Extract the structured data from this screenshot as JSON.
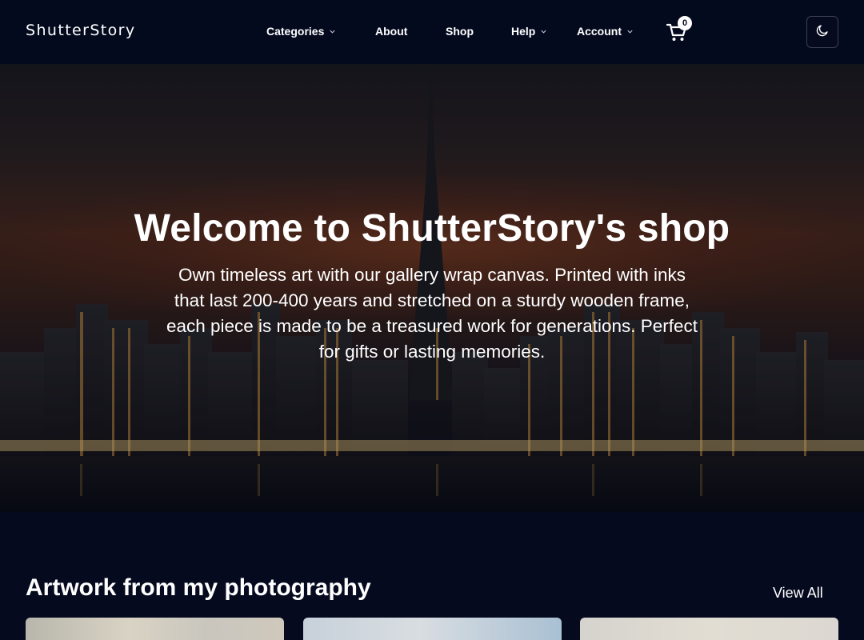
{
  "header": {
    "brand": "ShutterStory",
    "nav": [
      {
        "label": "Categories",
        "has_dropdown": true
      },
      {
        "label": "About",
        "has_dropdown": false
      },
      {
        "label": "Shop",
        "has_dropdown": false
      },
      {
        "label": "Help",
        "has_dropdown": true
      },
      {
        "label": "Account",
        "has_dropdown": true
      }
    ],
    "cart_icon": "cart-icon",
    "cart_count": "0",
    "theme_toggle_icon": "moon-icon"
  },
  "hero": {
    "title": "Welcome to ShutterStory's shop",
    "text": "Own timeless art with our gallery wrap canvas. Printed with inks that last 200-400 years and stretched on a sturdy wooden frame, each piece is made to be a treasured work for generations. Perfect for gifts or lasting memories."
  },
  "section": {
    "title": "Artwork from my photography",
    "view_all": "View All"
  },
  "colors": {
    "background": "#050a1f",
    "header_bg": "#040a1e",
    "text": "#ffffff"
  }
}
